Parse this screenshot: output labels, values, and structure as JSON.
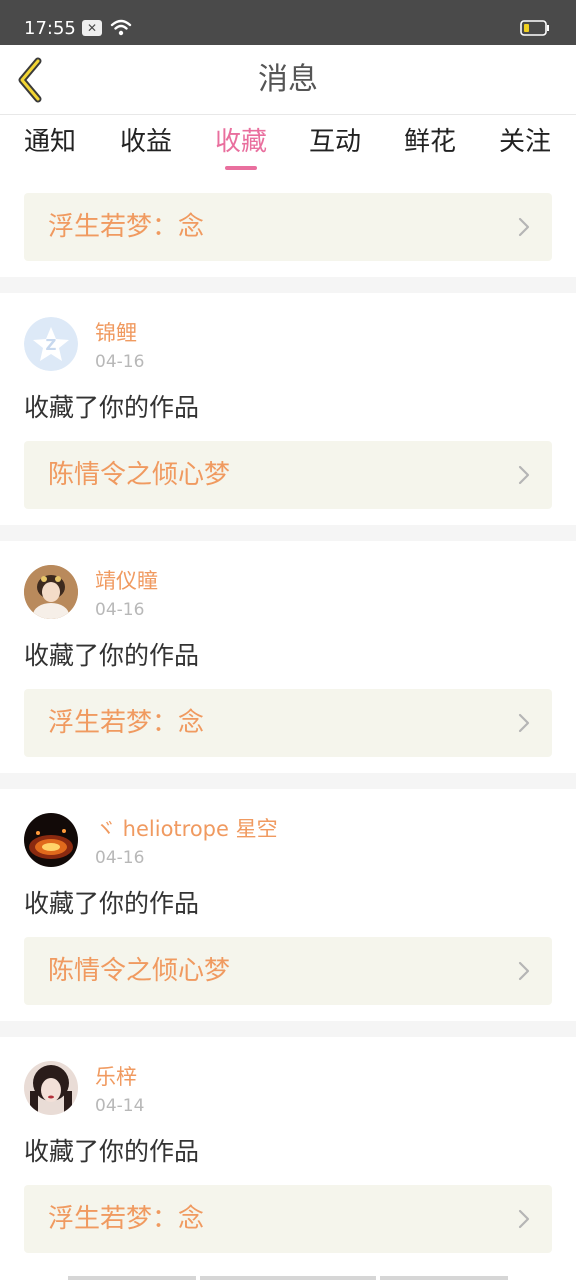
{
  "status": {
    "time": "17:55"
  },
  "header": {
    "title": "消息"
  },
  "tabs": [
    {
      "label": "通知"
    },
    {
      "label": "收益"
    },
    {
      "label": "收藏"
    },
    {
      "label": "互动"
    },
    {
      "label": "鲜花"
    },
    {
      "label": "关注"
    }
  ],
  "active_tab": "收藏",
  "top_card": {
    "title": "浮生若梦：念"
  },
  "messages": [
    {
      "user": "锦鲤",
      "date": "04-16",
      "text": "收藏了你的作品",
      "work": "陈情令之倾心梦"
    },
    {
      "user": "靖仪瞳",
      "date": "04-16",
      "text": "收藏了你的作品",
      "work": "浮生若梦：念"
    },
    {
      "user": "ヾ heliotrope 星空",
      "date": "04-16",
      "text": "收藏了你的作品",
      "work": "陈情令之倾心梦"
    },
    {
      "user": "乐梓",
      "date": "04-14",
      "text": "收藏了你的作品",
      "work": "浮生若梦：念"
    }
  ],
  "colors": {
    "accent": "#e96f9e",
    "link": "#f09a60",
    "card_bg": "#f5f5ec",
    "status_bar": "#4a4a4a"
  }
}
